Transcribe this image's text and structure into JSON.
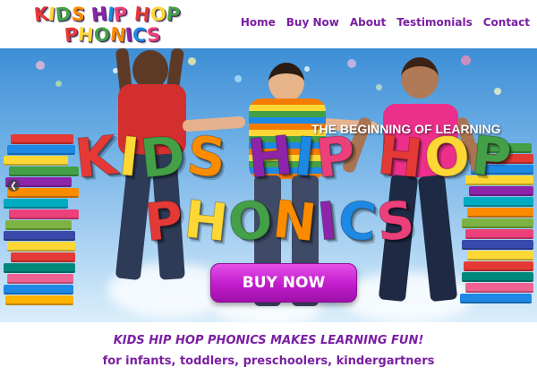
{
  "logo": {
    "line1": "KIDS HIP HOP",
    "line2": "PHONICS"
  },
  "nav": {
    "items": [
      "Home",
      "Buy Now",
      "About",
      "Testimonials",
      "Contact"
    ]
  },
  "hero": {
    "tagline": "THE BEGINNING OF LEARNING",
    "title_line1": "KIDS HIP HOP",
    "title_line2": "PHONICS",
    "buy_button": "BUY NOW",
    "prev_icon": "chevron-left-icon"
  },
  "content": {
    "headline": "KIDS HIP HOP PHONICS MAKES LEARNING FUN!",
    "subhead": "for infants, toddlers, preschoolers, kindergartners"
  },
  "colors": {
    "brand_purple": "#7a1fa2",
    "button_magenta": "#c11ccc",
    "letter_palette": [
      "#e53935",
      "#fdd835",
      "#43a047",
      "#fb8c00",
      "#8e24aa",
      "#1e88e5",
      "#ec407a"
    ]
  }
}
